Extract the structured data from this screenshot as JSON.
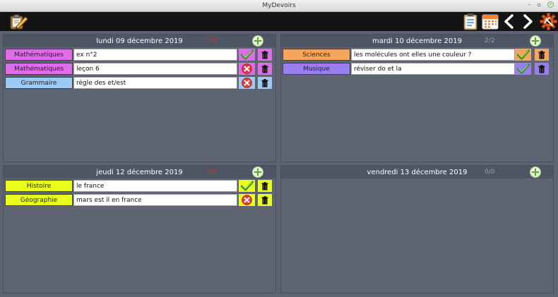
{
  "window": {
    "title": "MyDevoirs"
  },
  "toolbar": {
    "left_icon": "clipboard-pencil-icon",
    "right_icons": [
      "clipboard-list-icon",
      "calendar-icon",
      "chevron-left-icon",
      "chevron-right-icon",
      "gear-icon"
    ]
  },
  "colors": {
    "maths": "#e06de8",
    "grammaire": "#9ec9f2",
    "sciences": "#f6a55a",
    "musique": "#9a7ef0",
    "histoire": "#e9ff1c",
    "geographie": "#e9ff1c",
    "done": "#3fa626",
    "not_done": "#e53b3b"
  },
  "days": [
    {
      "title": "lundi 09 décembre 2019",
      "count": "1/3",
      "count_color": "#e02b2b",
      "tasks": [
        {
          "subject": "Mathématiques",
          "text": "ex n°2",
          "done": true
        },
        {
          "subject": "Mathématiques",
          "text": "leçon 6",
          "done": false
        },
        {
          "subject": "Grammaire",
          "text": "règle des et/est",
          "done": false
        }
      ]
    },
    {
      "title": "mardi 10 décembre 2019",
      "count": "2/2",
      "count_color": "#9aa0aa",
      "tasks": [
        {
          "subject": "Sciences",
          "text": "les molécules ont elles une couleur ?",
          "done": true
        },
        {
          "subject": "Musique",
          "text": "réviser do et la",
          "done": true
        }
      ]
    },
    {
      "title": "jeudi 12 décembre 2019",
      "count": "1/2",
      "count_color": "#e02b2b",
      "tasks": [
        {
          "subject": "Histoire",
          "text": "le france",
          "done": true
        },
        {
          "subject": "Géographie",
          "text": "mars est il en france",
          "done": false
        }
      ]
    },
    {
      "title": "vendredi 13 décembre 2019",
      "count": "0/0",
      "count_color": "#9aa0aa",
      "tasks": []
    }
  ]
}
